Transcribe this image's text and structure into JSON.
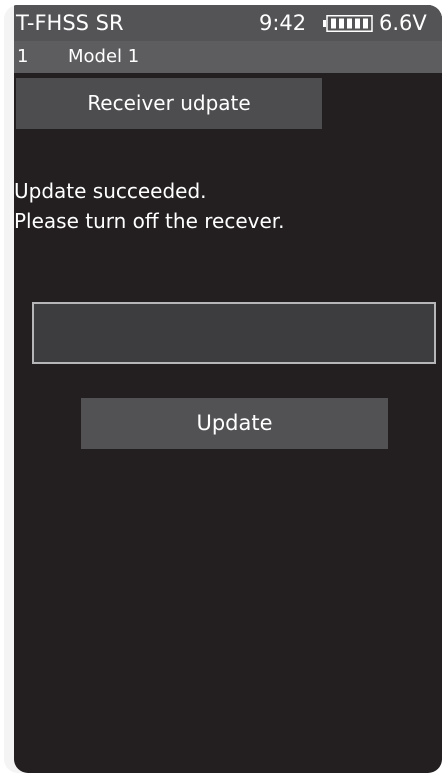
{
  "status_bar": {
    "protocol": "T-FHSS SR",
    "time": "9:42",
    "battery_icon": "battery-icon",
    "voltage": "6.6V"
  },
  "model": {
    "number": "1",
    "name": "Model 1"
  },
  "screen": {
    "title": "Receiver udpate",
    "message_line1": "Update succeeded.",
    "message_line2": "Please turn off the recever.",
    "progress_fraction": 0,
    "update_button_label": "Update"
  },
  "colors": {
    "screen_background": "#231f20",
    "status_bar": "#545356",
    "model_bar": "#5d5c5f",
    "button": "#525154",
    "text": "#ffffff"
  }
}
